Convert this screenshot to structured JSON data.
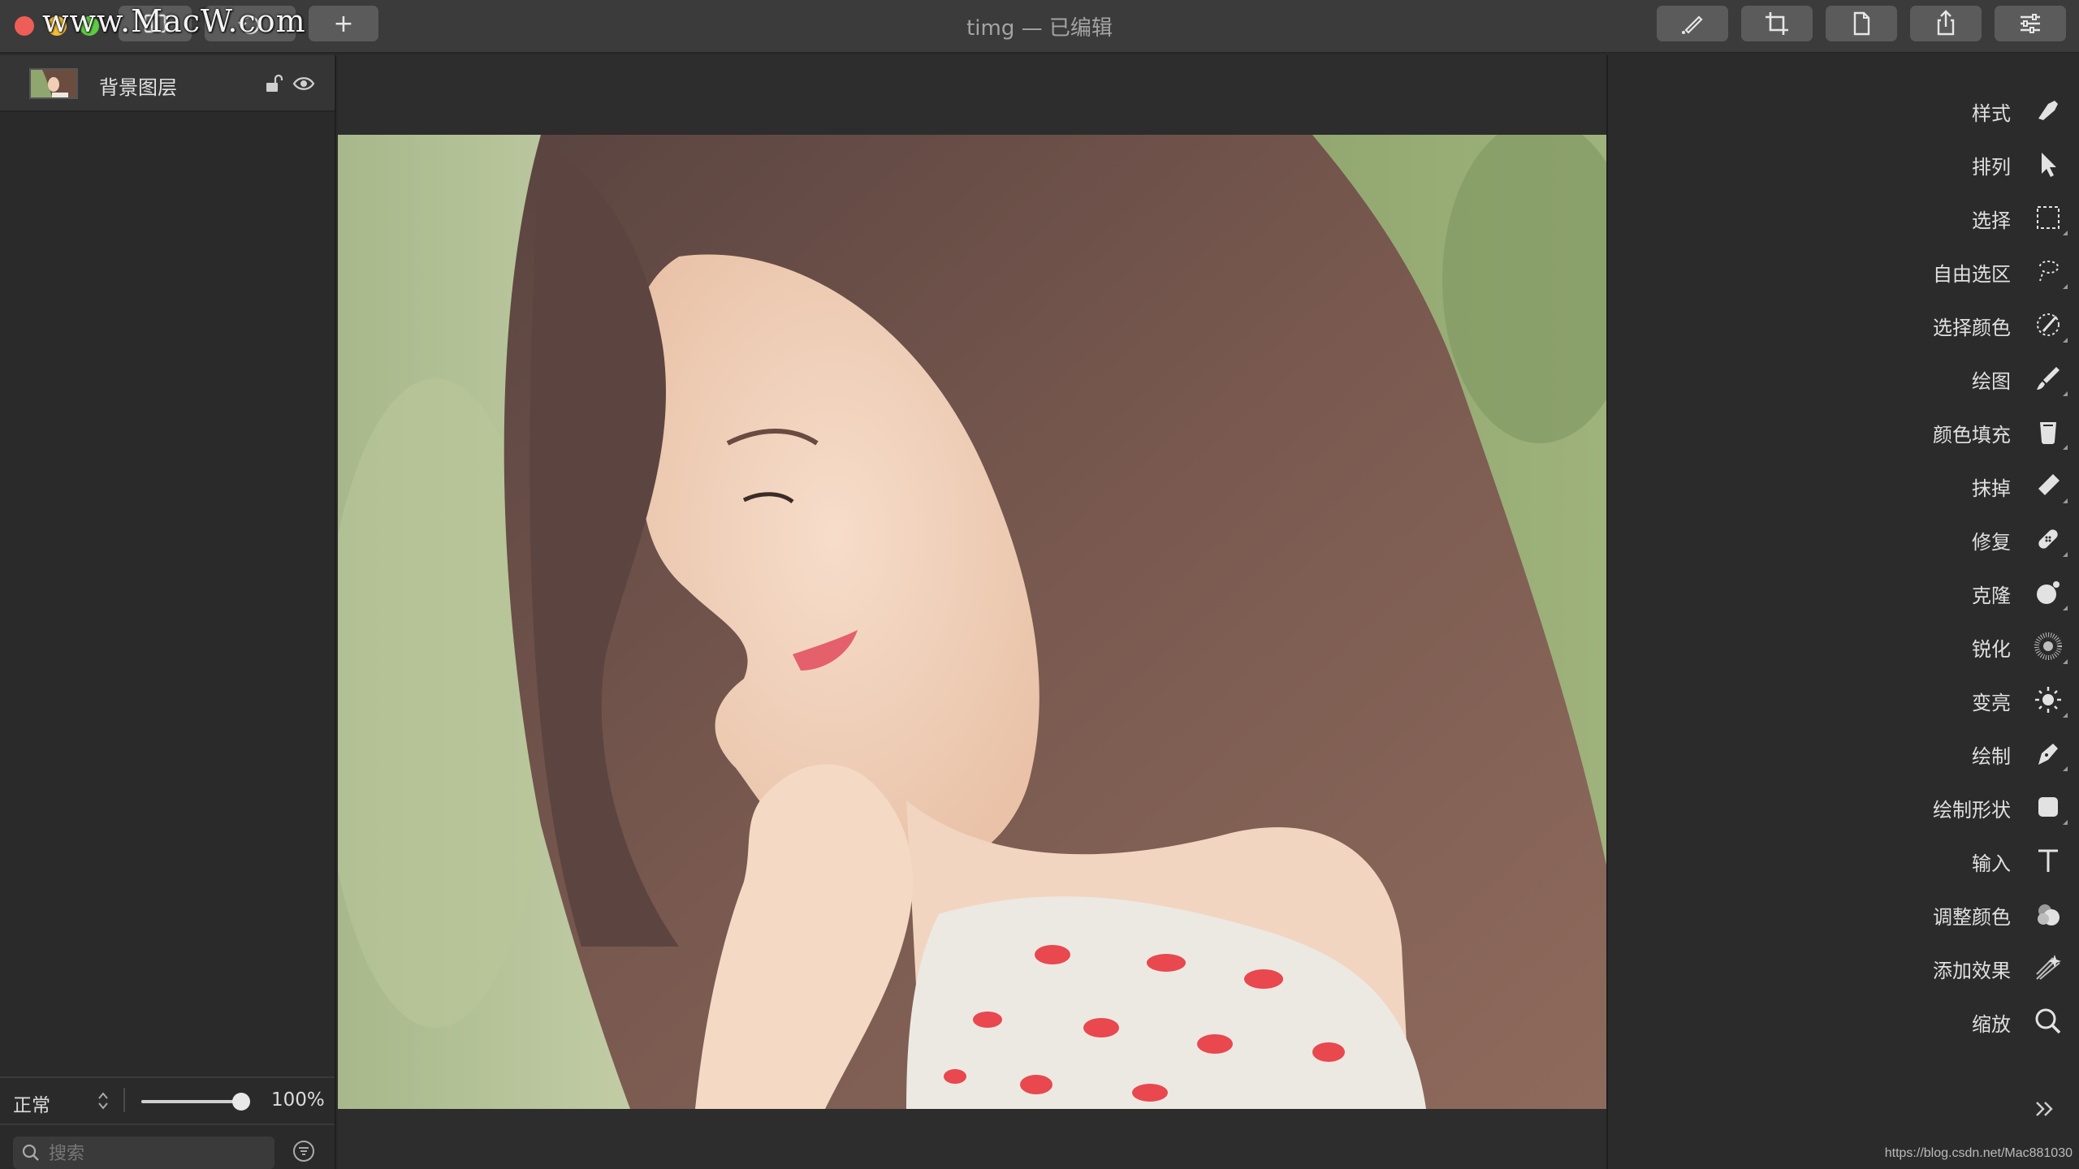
{
  "window": {
    "title": "timg — 已编辑",
    "watermark": "www.MacW.com"
  },
  "toolbar": {
    "add_label": "+",
    "left_buttons": [
      "sidebar-toggle",
      "undo-redo"
    ],
    "right_buttons": [
      "brush-tool-toggle",
      "crop",
      "document",
      "share",
      "adjustments"
    ]
  },
  "layers": {
    "items": [
      {
        "name": "背景图层"
      }
    ],
    "blend_mode": "正常",
    "opacity": "100%",
    "opacity_value": 1.0,
    "search_placeholder": "搜索"
  },
  "tools": {
    "items": [
      {
        "label": "样式",
        "icon": "style-icon"
      },
      {
        "label": "排列",
        "icon": "arrange-icon"
      },
      {
        "label": "选择",
        "icon": "select-icon"
      },
      {
        "label": "自由选区",
        "icon": "lasso-icon"
      },
      {
        "label": "选择颜色",
        "icon": "color-select-icon"
      },
      {
        "label": "绘图",
        "icon": "paint-icon"
      },
      {
        "label": "颜色填充",
        "icon": "fill-icon"
      },
      {
        "label": "抹掉",
        "icon": "eraser-icon"
      },
      {
        "label": "修复",
        "icon": "repair-icon"
      },
      {
        "label": "克隆",
        "icon": "clone-icon"
      },
      {
        "label": "锐化",
        "icon": "sharpen-icon"
      },
      {
        "label": "变亮",
        "icon": "lighten-icon"
      },
      {
        "label": "绘制",
        "icon": "pen-icon"
      },
      {
        "label": "绘制形状",
        "icon": "shape-icon"
      },
      {
        "label": "输入",
        "icon": "text-icon"
      },
      {
        "label": "调整颜色",
        "icon": "adjust-color-icon"
      },
      {
        "label": "添加效果",
        "icon": "effects-icon"
      },
      {
        "label": "缩放",
        "icon": "zoom-icon"
      }
    ]
  },
  "footer_url": "https://blog.csdn.net/Mac881030"
}
